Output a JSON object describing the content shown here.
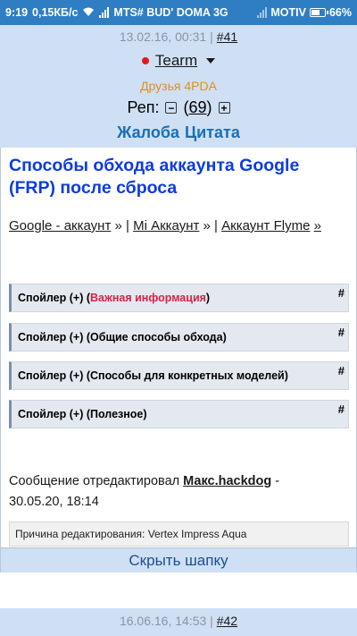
{
  "status_bar": {
    "time": "9:19",
    "speed": "0,15КБ/с",
    "carrier1": "MTS# BUD' DOMA 3G",
    "carrier2": "MOTIV",
    "battery": "66%",
    "battery_level": 0.66,
    "icons": [
      "wifi-icon",
      "signal-icon",
      "battery-icon"
    ]
  },
  "post": {
    "date": "13.02.16, 00:31",
    "separator": "|",
    "number": "#41",
    "author": "Tearm",
    "group": "Друзья 4PDA",
    "rep_label": "Реп:",
    "rep_open": "(",
    "rep_value": "69",
    "rep_close": ")",
    "rep_minus": "−",
    "rep_plus": "+",
    "action_complaint": "Жалоба",
    "action_quote": "Цитата",
    "title": "Способы обхода аккаунта Google (FRP) после сброса",
    "links": [
      {
        "label": "Google - аккаунт",
        "arrow": "»"
      },
      {
        "label": "Mi Аккаунт",
        "arrow": "»"
      },
      {
        "label": "Аккаунт Flyme",
        "arrow": "»"
      }
    ],
    "link_separator": " | ",
    "spoilers": [
      {
        "prefix": "Спойлер (+) (",
        "highlight": "Важная информация",
        "suffix": ")",
        "hash": "#"
      },
      {
        "prefix": "Спойлер (+) (Общие способы обхода)",
        "hash": "#"
      },
      {
        "prefix": "Спойлер (+) (Способы для конкретных моделей)",
        "hash": "#"
      },
      {
        "prefix": "Спойлер (+) (Полезное)",
        "hash": "#"
      }
    ],
    "edited_prefix": "Сообщение отредактировал",
    "edited_by": "Макс.hackdog",
    "edited_dash": " -",
    "edited_date": "30.05.20, 18:14",
    "edit_reason": "Причина редактирования: Vertex Impress Aqua",
    "hide_header": "Скрыть шапку"
  },
  "next_post": {
    "date": "16.06.16, 14:53",
    "separator": "|",
    "number": "#42"
  },
  "colors": {
    "status_bar": "#2f7ec4",
    "header_bg": "#cfe0f5",
    "title": "#0d3ce0",
    "actions": "#1a6fb7",
    "group": "#e0901c",
    "important": "#d3244b",
    "online_dot": "#e31919"
  }
}
